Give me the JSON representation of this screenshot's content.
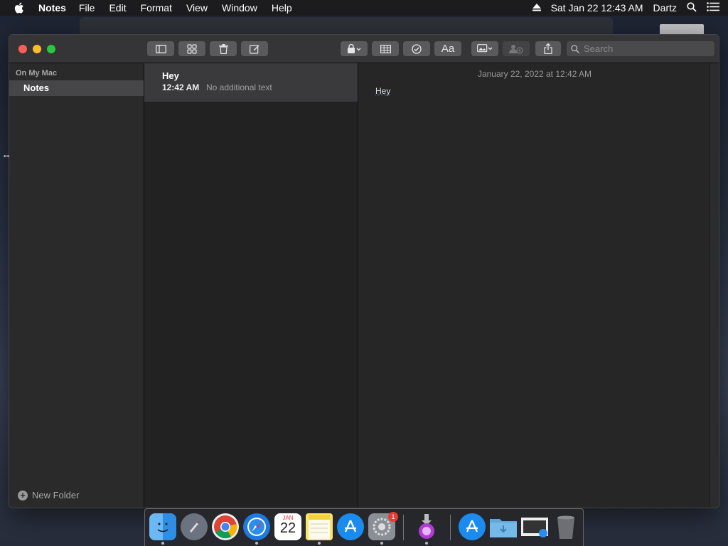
{
  "menubar": {
    "app_name": "Notes",
    "items": [
      "File",
      "Edit",
      "Format",
      "View",
      "Window",
      "Help"
    ],
    "clock": "Sat Jan 22  12:43 AM",
    "user": "Dartz"
  },
  "toolbar": {
    "search_placeholder": "Search",
    "font_button_label": "Aa"
  },
  "sidebar": {
    "section_title": "On My Mac",
    "folders": [
      {
        "label": "Notes"
      }
    ],
    "new_folder_label": "New Folder"
  },
  "note_list": {
    "items": [
      {
        "title": "Hey",
        "time": "12:42 AM",
        "preview": "No additional text"
      }
    ]
  },
  "editor": {
    "date": "January 22, 2022 at 12:42 AM",
    "body": "Hey"
  },
  "dock": {
    "calendar_month": "JAN",
    "calendar_day": "22",
    "settings_badge": "1"
  },
  "colors": {
    "close": "#ff5f57",
    "minimize": "#febc2e",
    "maximize": "#28c840",
    "selected_folder": "#464648"
  }
}
